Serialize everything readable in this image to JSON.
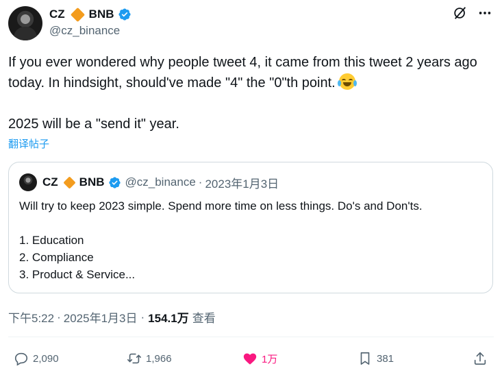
{
  "author": {
    "name": "CZ",
    "name_suffix": "BNB",
    "handle": "@cz_binance"
  },
  "tweet": {
    "paragraphs": [
      "If you ever wondered why people tweet 4, it came from this tweet 2 years ago today. In hindsight, should've made \"4\" the \"0\"th point.",
      "2025 will be a \"send it\" year."
    ],
    "translate_label": "翻译帖子"
  },
  "quoted": {
    "name": "CZ",
    "name_suffix": "BNB",
    "handle": "@cz_binance",
    "separator": "·",
    "date": "2023年1月3日",
    "line1": "Will try to keep 2023 simple. Spend more time on less things. Do's and Don'ts.",
    "list": [
      "1. Education",
      "2. Compliance",
      "3. Product & Service..."
    ]
  },
  "meta": {
    "time": "下午5:22",
    "separator": "·",
    "date": "2025年1月3日",
    "views": "154.1万",
    "views_label": "查看"
  },
  "actions": {
    "replies": "2,090",
    "reposts": "1,966",
    "likes": "1万",
    "bookmarks": "381"
  },
  "icons": {
    "verified": "verified-badge-icon",
    "grok": "grok-icon",
    "more": "more-icon",
    "reply": "reply-icon",
    "repost": "repost-icon",
    "like": "heart-icon",
    "bookmark": "bookmark-icon",
    "share": "share-icon"
  },
  "colors": {
    "accent": "#1d9bf0",
    "like": "#f91880",
    "diamond": "#f39c1e",
    "muted": "#536471"
  }
}
